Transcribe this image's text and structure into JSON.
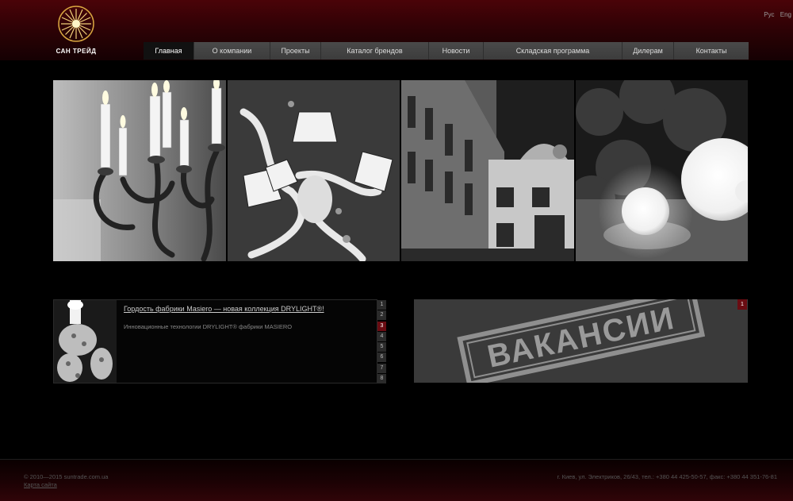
{
  "brand": {
    "name": "САН ТРЕЙД",
    "accent": "#f2c94c"
  },
  "lang": {
    "ru": "Рус",
    "en": "Eng"
  },
  "nav": {
    "items": [
      {
        "label": "Главная",
        "active": true
      },
      {
        "label": "О компании"
      },
      {
        "label": "Проекты"
      },
      {
        "label": "Каталог брендов"
      },
      {
        "label": "Новости"
      },
      {
        "label": "Складская программа"
      },
      {
        "label": "Дилерам"
      },
      {
        "label": "Контакты"
      }
    ]
  },
  "news": {
    "title": "Гордость фабрики Masiero — новая коллекция DRYLIGHT®!",
    "description": "Инновационные технологии DRYLIGHT® фабрики MASIERO",
    "pages": [
      "1",
      "2",
      "3",
      "4",
      "5",
      "6",
      "7",
      "8"
    ],
    "active_page": "3"
  },
  "banner": {
    "stamp_text": "ВАКАНСИИ",
    "pages": [
      "1"
    ],
    "active_page": "1"
  },
  "footer": {
    "copyright": "© 2010—2015 suntrade.com.ua",
    "sitemap": "Карта сайта",
    "address": "г. Киев, ул. Электриков, 26/43, тел.: +380 44 425-50-57, факс: +380 44 351-76-81"
  },
  "colors": {
    "header_red": "#4a0308",
    "active_page": "#6a0c12",
    "nav_gray": "#444444"
  }
}
